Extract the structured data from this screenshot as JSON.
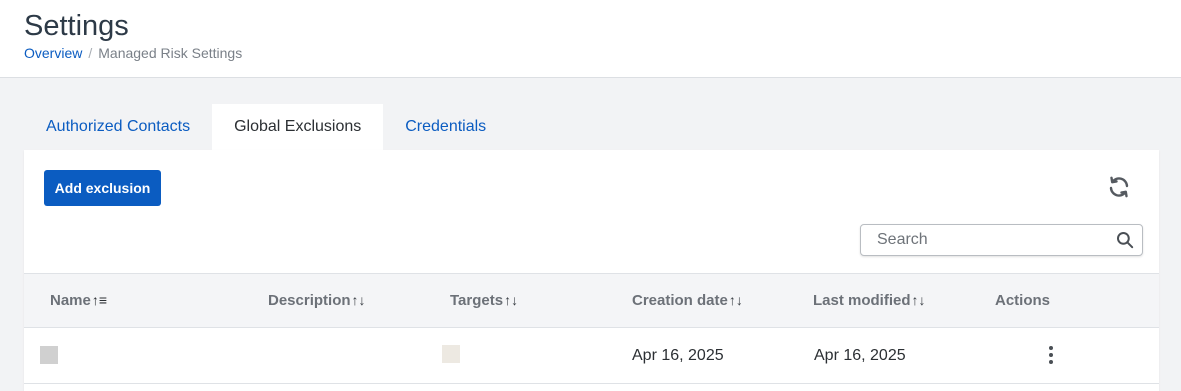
{
  "header": {
    "title": "Settings",
    "breadcrumb": {
      "link": "Overview",
      "separator": "/",
      "current": "Managed Risk Settings"
    }
  },
  "tabs": [
    {
      "label": "Authorized Contacts",
      "active": false
    },
    {
      "label": "Global Exclusions",
      "active": true
    },
    {
      "label": "Credentials",
      "active": false
    }
  ],
  "toolbar": {
    "add_label": "Add exclusion",
    "refresh_icon": "refresh-icon",
    "search": {
      "placeholder": "Search",
      "value": "",
      "icon": "search-icon"
    }
  },
  "table": {
    "columns": [
      {
        "label": "Name",
        "sort": "↑≡"
      },
      {
        "label": "Description",
        "sort": "↑↓"
      },
      {
        "label": "Targets",
        "sort": "↑↓"
      },
      {
        "label": "Creation date",
        "sort": "↑↓"
      },
      {
        "label": "Last modified",
        "sort": "↑↓"
      },
      {
        "label": "Actions",
        "sort": ""
      }
    ],
    "rows": [
      {
        "name_swatch": "#d0d0d0",
        "description": "",
        "targets_swatch": "#ede9e2",
        "creation_date": "Apr 16, 2025",
        "last_modified": "Apr 16, 2025",
        "actions_icon": "more-vertical-icon"
      }
    ]
  },
  "colors": {
    "accent": "#0b5cc1",
    "page_bg": "#f2f3f5",
    "header_bg": "#f4f5f7"
  }
}
